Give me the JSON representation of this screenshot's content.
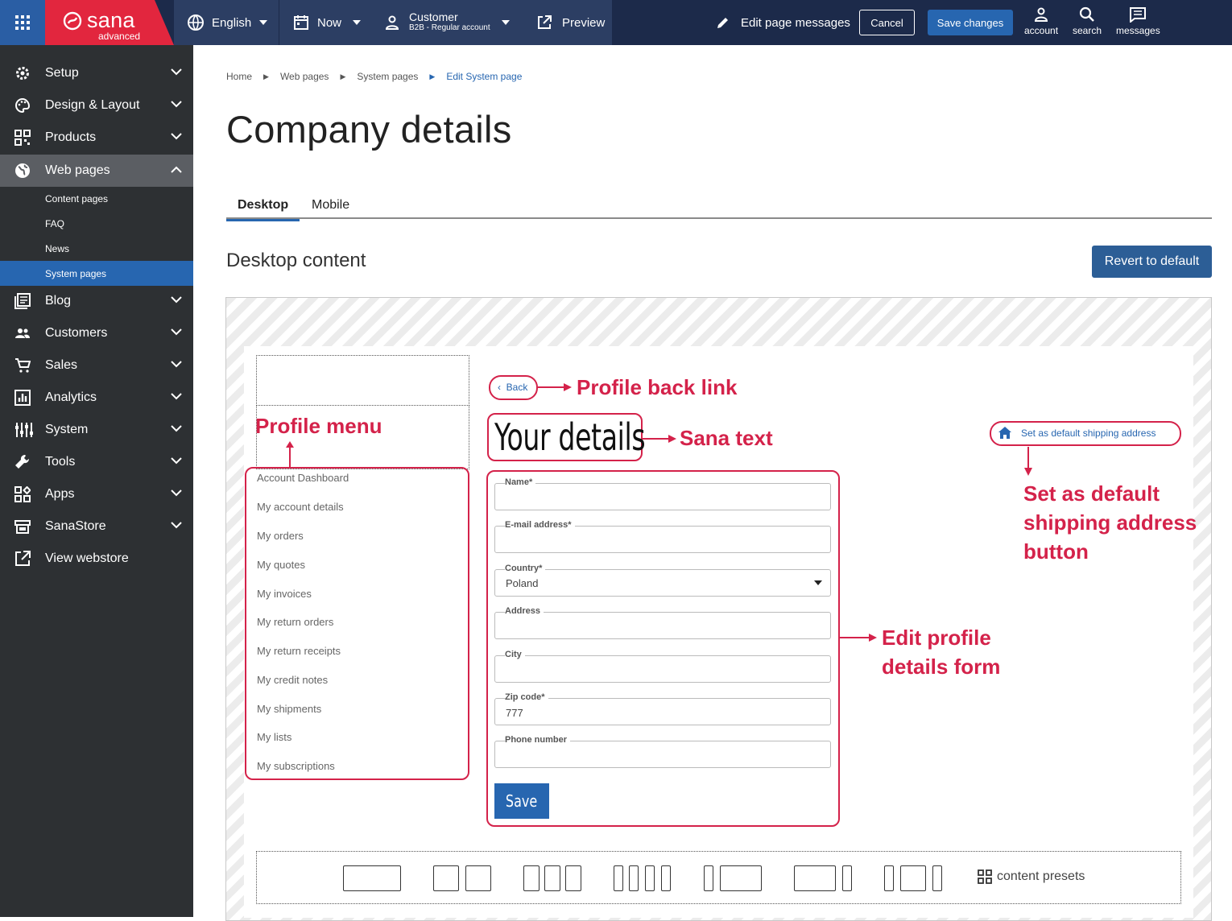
{
  "topbar": {
    "brand_name": "sana",
    "brand_sub": "advanced",
    "language": "English",
    "time": "Now",
    "customer_title": "Customer",
    "customer_sub": "B2B - Regular account",
    "preview": "Preview",
    "edit_messages": "Edit page messages",
    "cancel": "Cancel",
    "save_changes": "Save changes",
    "account": "account",
    "search": "search",
    "messages": "messages",
    "colors": {
      "bar": "#1c2a4a",
      "brand": "#e2263e",
      "accent": "#2766b0"
    }
  },
  "sidebar": {
    "items": [
      {
        "label": "Setup",
        "icon": "gear-icon"
      },
      {
        "label": "Design & Layout",
        "icon": "palette-icon"
      },
      {
        "label": "Products",
        "icon": "qr-grid-icon"
      },
      {
        "label": "Web pages",
        "icon": "globe-icon"
      },
      {
        "label": "Blog",
        "icon": "blog-icon"
      },
      {
        "label": "Customers",
        "icon": "people-icon"
      },
      {
        "label": "Sales",
        "icon": "cart-icon"
      },
      {
        "label": "Analytics",
        "icon": "analytics-icon"
      },
      {
        "label": "System",
        "icon": "sliders-icon"
      },
      {
        "label": "Tools",
        "icon": "wrench-icon"
      },
      {
        "label": "Apps",
        "icon": "apps-icon"
      },
      {
        "label": "SanaStore",
        "icon": "store-icon"
      },
      {
        "label": "View webstore",
        "icon": "external-link-icon"
      }
    ],
    "sub_items": [
      "Content pages",
      "FAQ",
      "News",
      "System pages"
    ]
  },
  "breadcrumb": [
    "Home",
    "Web pages",
    "System pages",
    "Edit System page"
  ],
  "page_title": "Company details",
  "tabs": [
    "Desktop",
    "Mobile"
  ],
  "section_title": "Desktop content",
  "revert_button": "Revert to default",
  "preview": {
    "back_link": "Back",
    "heading": "Your details",
    "set_default": "Set as default shipping address",
    "menu": [
      "Account Dashboard",
      "My account details",
      "My orders",
      "My quotes",
      "My invoices",
      "My return orders",
      "My return receipts",
      "My credit notes",
      "My shipments",
      "My lists",
      "My subscriptions"
    ],
    "form": {
      "name_label": "Name*",
      "email_label": "E-mail address*",
      "country_label": "Country*",
      "country_value": "Poland",
      "address_label": "Address",
      "city_label": "City",
      "zip_label": "Zip code*",
      "zip_value": "777",
      "phone_label": "Phone number",
      "save": "Save"
    },
    "content_presets": "content presets"
  },
  "annotations": {
    "profile_menu": "Profile menu",
    "back_link": "Profile back link",
    "sana_text": "Sana text",
    "set_default_1": "Set as default",
    "set_default_2": "shipping address",
    "set_default_3": "button",
    "form_1": "Edit profile",
    "form_2": "details form",
    "color": "#d4224a"
  }
}
